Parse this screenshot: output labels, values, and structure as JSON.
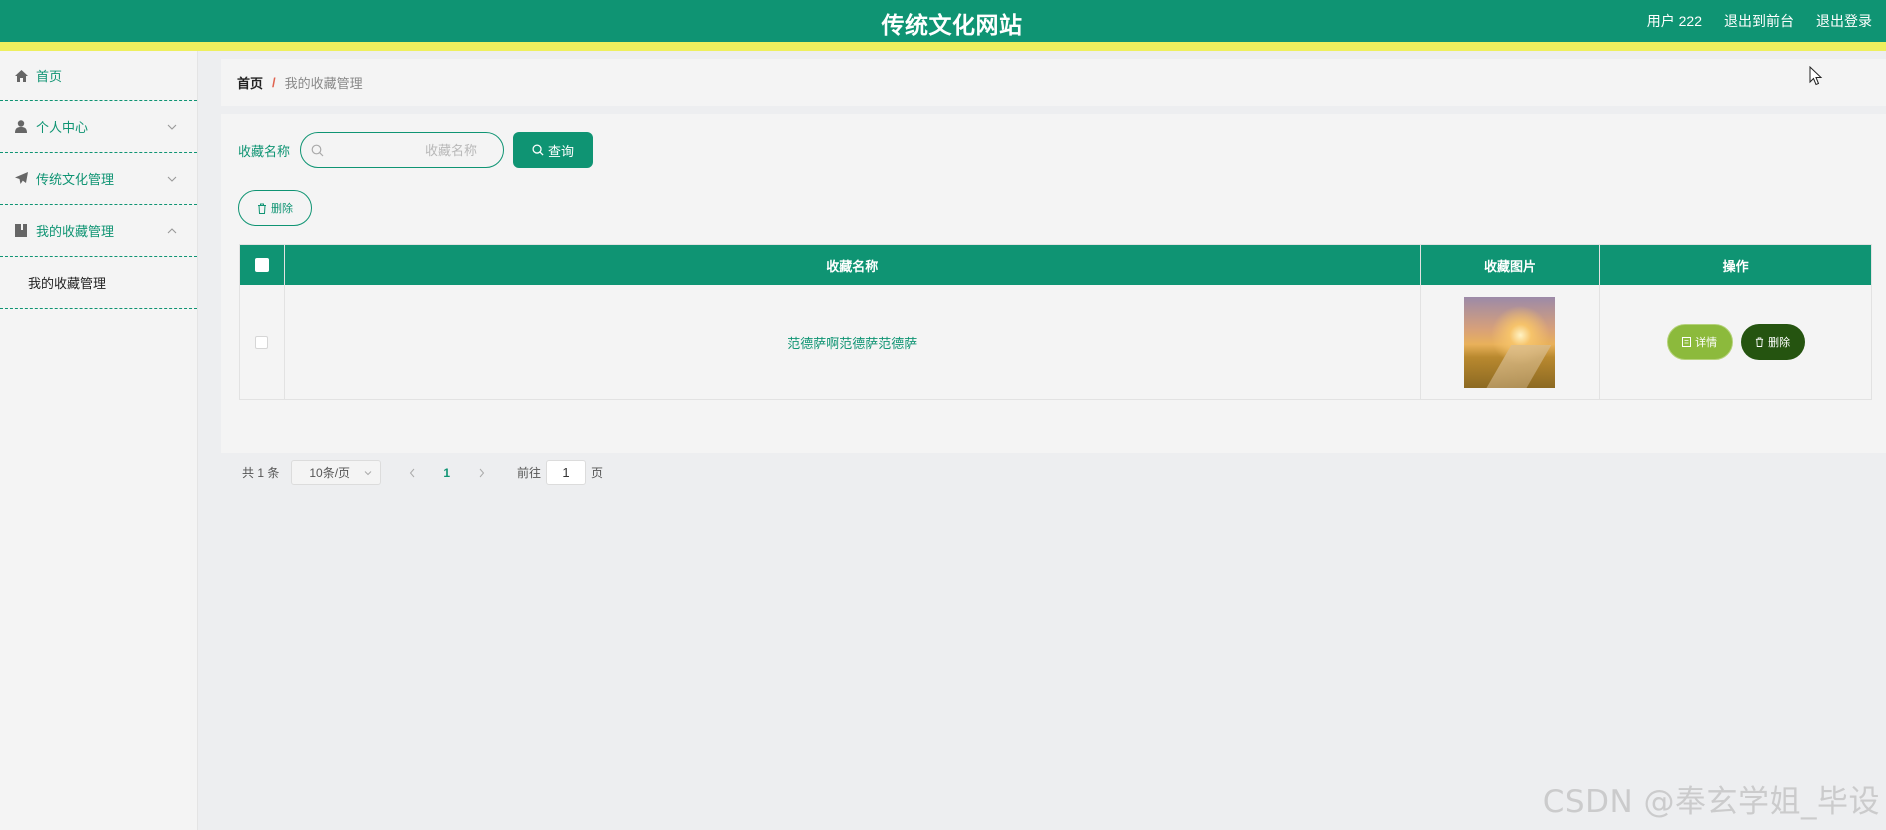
{
  "header": {
    "title": "传统文化网站",
    "links": {
      "user": "用户 222",
      "frontend": "退出到前台",
      "logout": "退出登录"
    }
  },
  "sidebar": {
    "items": [
      {
        "label": "首页",
        "icon": "home-icon"
      },
      {
        "label": "个人中心",
        "icon": "user-icon"
      },
      {
        "label": "传统文化管理",
        "icon": "paper-plane-icon"
      },
      {
        "label": "我的收藏管理",
        "icon": "book-icon"
      }
    ],
    "submenu": {
      "label": "我的收藏管理"
    }
  },
  "breadcrumb": {
    "home": "首页",
    "separator": "/",
    "current": "我的收藏管理"
  },
  "search": {
    "label": "收藏名称",
    "placeholder": "收藏名称",
    "button": "查询"
  },
  "actions": {
    "delete": "删除"
  },
  "table": {
    "headers": [
      "",
      "收藏名称",
      "收藏图片",
      "操作"
    ],
    "rows": [
      {
        "name": "范德萨啊范德萨范德萨",
        "detail_btn": "详情",
        "delete_btn": "删除"
      }
    ]
  },
  "pagination": {
    "total": "共 1 条",
    "page_size": "10条/页",
    "current_page": "1",
    "goto_label": "前往",
    "goto_value": "1",
    "page_suffix": "页"
  },
  "watermark": "CSDN @奉玄学姐_毕设",
  "colors": {
    "primary": "#0f9473",
    "accent_stripe": "#eeef5e",
    "detail_button": "#8cba3c",
    "delete_button": "#255410"
  }
}
